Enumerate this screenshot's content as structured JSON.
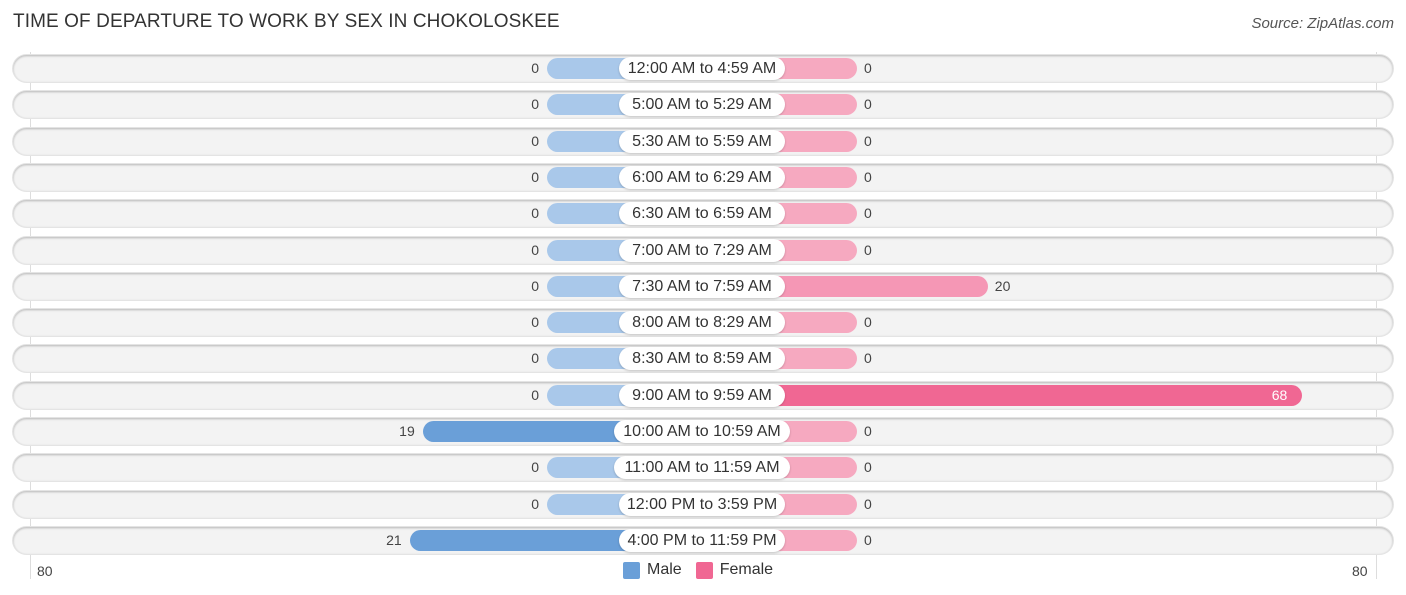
{
  "chart_data": {
    "type": "bar",
    "orientation": "horizontal-diverging",
    "title": "TIME OF DEPARTURE TO WORK BY SEX IN CHOKOLOSKEE",
    "source": "Source: ZipAtlas.com",
    "categories": [
      "12:00 AM to 4:59 AM",
      "5:00 AM to 5:29 AM",
      "5:30 AM to 5:59 AM",
      "6:00 AM to 6:29 AM",
      "6:30 AM to 6:59 AM",
      "7:00 AM to 7:29 AM",
      "7:30 AM to 7:59 AM",
      "8:00 AM to 8:29 AM",
      "8:30 AM to 8:59 AM",
      "9:00 AM to 9:59 AM",
      "10:00 AM to 10:59 AM",
      "11:00 AM to 11:59 AM",
      "12:00 PM to 3:59 PM",
      "4:00 PM to 11:59 PM"
    ],
    "series": [
      {
        "name": "Male",
        "color": "#6a9fd8",
        "values": [
          0,
          0,
          0,
          0,
          0,
          0,
          0,
          0,
          0,
          0,
          19,
          0,
          0,
          21
        ]
      },
      {
        "name": "Female",
        "color": "#f06793",
        "values": [
          0,
          0,
          0,
          0,
          0,
          0,
          20,
          0,
          0,
          68,
          0,
          0,
          0,
          0
        ]
      }
    ],
    "axis": {
      "left_label": "80",
      "right_label": "80",
      "range": [
        -80,
        80
      ]
    },
    "legend": {
      "position": "bottom-center",
      "items": [
        "Male",
        "Female"
      ]
    }
  }
}
